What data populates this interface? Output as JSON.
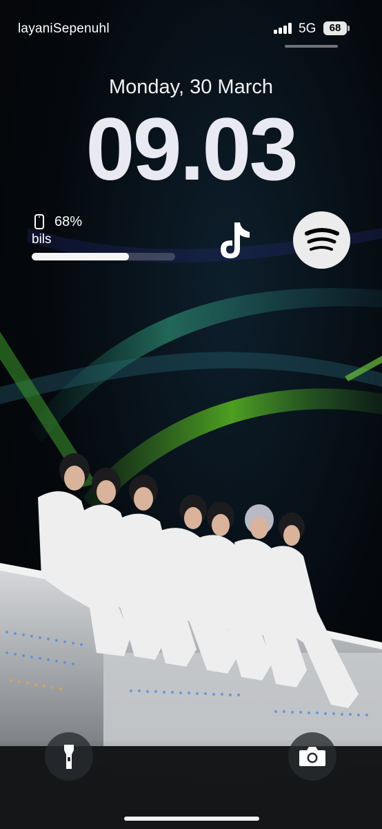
{
  "status_bar": {
    "carrier": "layaniSepenuhl",
    "network": "5G",
    "battery_level": "68"
  },
  "lock_screen": {
    "date": "Monday, 30 March",
    "time": "09.03"
  },
  "battery_widget": {
    "percent_label": "68%",
    "device_name": "bils",
    "level": 0.68
  },
  "app_widgets": {
    "tiktok_icon": "tiktok-icon",
    "spotify_icon": "spotify-icon"
  },
  "controls": {
    "flashlight_icon": "flashlight-icon",
    "camera_icon": "camera-icon"
  },
  "colors": {
    "time_text": "#e9e9f1",
    "widget_fill": "#f4f4f6",
    "control_bg": "#282c30"
  }
}
